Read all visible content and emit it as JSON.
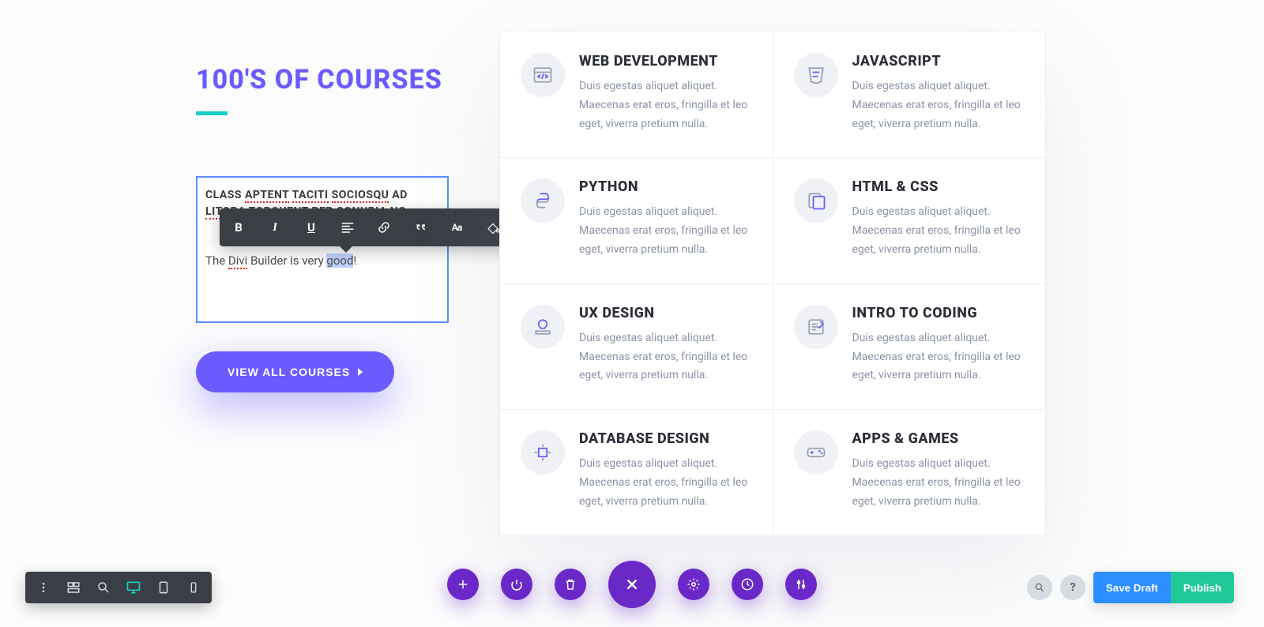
{
  "heading": "100'S OF COURSES",
  "editor": {
    "strong_line1_pre": "CLASS ",
    "strong_aptent": "APTENT",
    "strong_sp1": " ",
    "strong_taciti": "TACITI",
    "strong_sp2": " ",
    "strong_sociosqu": "SOCIOSQU",
    "strong_line1_post": " AD ",
    "strong_litora": "LITORA",
    "strong_mid": " TORQUENT PER CONUBIA ",
    "strong_no": "NO",
    "para_pre": "The ",
    "para_divi": "Divi",
    "para_mid": " Builder is very ",
    "para_sel": "good",
    "para_post": "!"
  },
  "cta_label": "VIEW ALL COURSES",
  "courses": [
    {
      "title": "WEB DEVELOPMENT",
      "desc": "Duis egestas aliquet aliquet. Maecenas erat eros, fringilla et leo eget, viverra pretium nulla."
    },
    {
      "title": "JAVASCRIPT",
      "desc": "Duis egestas aliquet aliquet. Maecenas erat eros, fringilla et leo eget, viverra pretium nulla."
    },
    {
      "title": "PYTHON",
      "desc": "Duis egestas aliquet aliquet. Maecenas erat eros, fringilla et leo eget, viverra pretium nulla."
    },
    {
      "title": "HTML & CSS",
      "desc": "Duis egestas aliquet aliquet. Maecenas erat eros, fringilla et leo eget, viverra pretium nulla."
    },
    {
      "title": "UX DESIGN",
      "desc": "Duis egestas aliquet aliquet. Maecenas erat eros, fringilla et leo eget, viverra pretium nulla."
    },
    {
      "title": "INTRO TO CODING",
      "desc": "Duis egestas aliquet aliquet. Maecenas erat eros, fringilla et leo eget, viverra pretium nulla."
    },
    {
      "title": "DATABASE DESIGN",
      "desc": "Duis egestas aliquet aliquet. Maecenas erat eros, fringilla et leo eget, viverra pretium nulla."
    },
    {
      "title": "APPS & GAMES",
      "desc": "Duis egestas aliquet aliquet. Maecenas erat eros, fringilla et leo eget, viverra pretium nulla."
    }
  ],
  "inline_toolbar": {
    "bold": "B",
    "italic": "I",
    "underline": "U",
    "font": "Aa"
  },
  "bottom_right": {
    "help": "?",
    "save_draft": "Save Draft",
    "publish": "Publish"
  },
  "colors": {
    "accent": "#6b5bff",
    "teal": "#18d1c6",
    "purple": "#6a28c9",
    "blue": "#2c8eff",
    "green": "#20c997"
  }
}
